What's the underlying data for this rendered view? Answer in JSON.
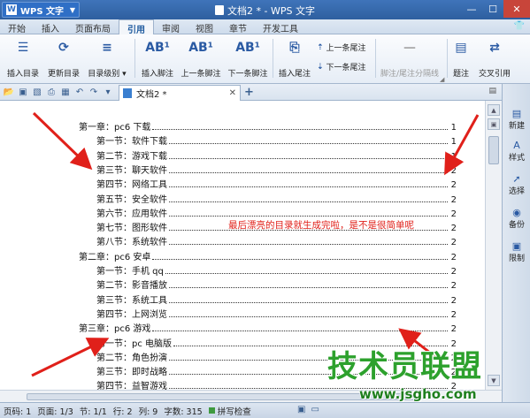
{
  "app": {
    "name": "WPS 文字",
    "window_title": "文档2 * - WPS 文字"
  },
  "menu_tabs": [
    "开始",
    "插入",
    "页面布局",
    "引用",
    "审阅",
    "视图",
    "章节",
    "开发工具"
  ],
  "ribbon": {
    "insert_toc": "插入目录",
    "update_toc": "更新目录",
    "toc_level": "目录级别",
    "insert_footnote": "插入脚注",
    "prev_footnote": "上一条脚注",
    "next_footnote": "下一条脚注",
    "insert_endnote": "插入尾注",
    "prev_endnote": "上一条尾注",
    "next_endnote": "下一条尾注",
    "separator": "脚注/尾注分隔线",
    "caption": "题注",
    "cross_ref": "交叉引用"
  },
  "document_tab": "文档2 *",
  "toc": [
    {
      "text": "第一章：pc6 下载",
      "page": "1",
      "level": 1
    },
    {
      "text": "第一节：软件下载",
      "page": "1",
      "level": 2
    },
    {
      "text": "第二节：游戏下载",
      "page": "1",
      "level": 2
    },
    {
      "text": "第三节：聊天软件",
      "page": "2",
      "level": 2
    },
    {
      "text": "第四节：网络工具",
      "page": "2",
      "level": 2
    },
    {
      "text": "第五节：安全软件",
      "page": "2",
      "level": 2
    },
    {
      "text": "第六节：应用软件",
      "page": "2",
      "level": 2
    },
    {
      "text": "第七节：图形软件",
      "page": "2",
      "level": 2
    },
    {
      "text": "第八节：系统软件",
      "page": "2",
      "level": 2
    },
    {
      "text": "第二章：pc6 安卓",
      "page": "2",
      "level": 1
    },
    {
      "text": "第一节：手机 qq",
      "page": "2",
      "level": 2
    },
    {
      "text": "第二节：影音播放",
      "page": "2",
      "level": 2
    },
    {
      "text": "第三节：系统工具",
      "page": "2",
      "level": 2
    },
    {
      "text": "第四节：上网浏览",
      "page": "2",
      "level": 2
    },
    {
      "text": "第三章：pc6 游戏",
      "page": "2",
      "level": 1
    },
    {
      "text": "第一节：pc 电脑版",
      "page": "2",
      "level": 2
    },
    {
      "text": "第二节：角色扮演",
      "page": "2",
      "level": 2
    },
    {
      "text": "第三节：即时战略",
      "page": "2",
      "level": 2
    },
    {
      "text": "第四节：益智游戏",
      "page": "2",
      "level": 2
    }
  ],
  "annotation": "最后漂亮的目录就生成完啦，是不是很简单呢",
  "right_pane": [
    "新建",
    "样式",
    "选择",
    "备份",
    "限制"
  ],
  "status": {
    "page_no": "页码: 1",
    "page_of": "页面: 1/3",
    "section": "节: 1/1",
    "row": "行: 2",
    "col": "列: 9",
    "words": "字数: 315",
    "spell": "拼写检查"
  },
  "watermark": {
    "brand": "技术员联盟",
    "url": "www.jsgho.com"
  },
  "colors": {
    "title_bar": "#2e5f9f",
    "annotation_red": "#e0201a",
    "watermark_green": "#2da12d"
  }
}
